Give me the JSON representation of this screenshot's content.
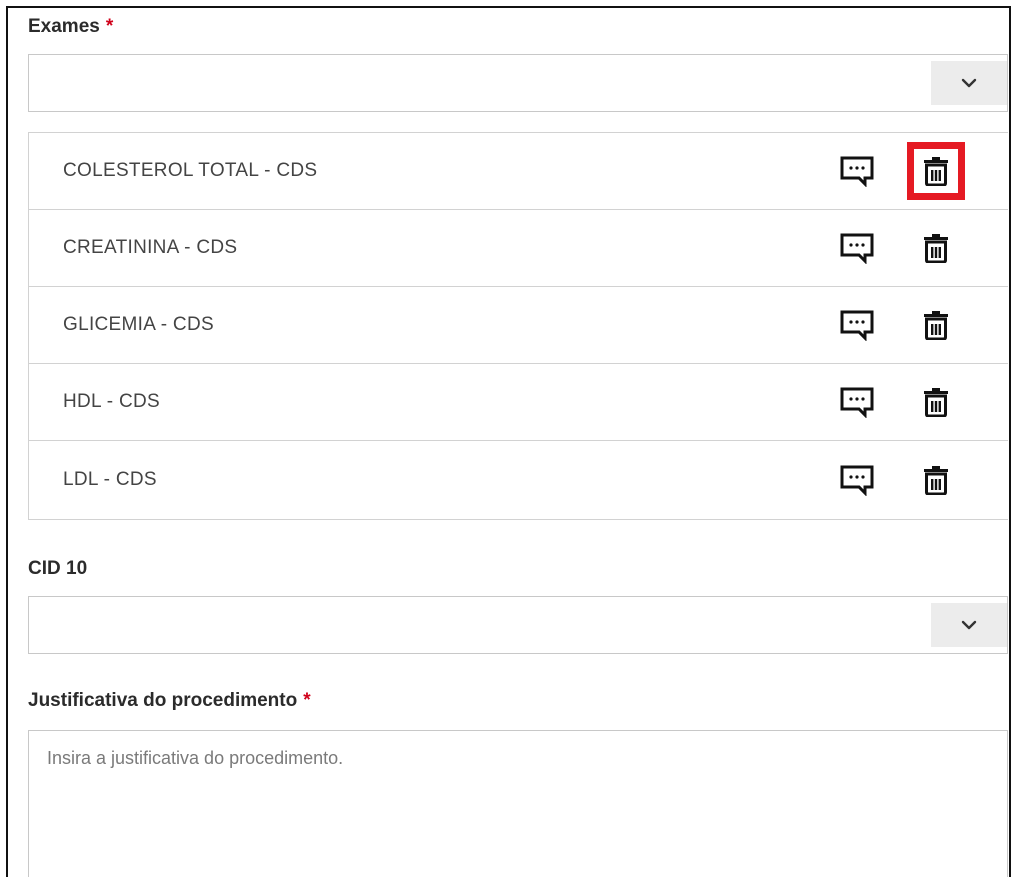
{
  "exames": {
    "label": "Exames",
    "required_mark": "*",
    "selected_value": "",
    "items": [
      {
        "label": "COLESTEROL TOTAL - CDS"
      },
      {
        "label": "CREATININA - CDS"
      },
      {
        "label": "GLICEMIA - CDS"
      },
      {
        "label": "HDL - CDS"
      },
      {
        "label": "LDL - CDS"
      }
    ]
  },
  "cid10": {
    "label": "CID 10",
    "selected_value": ""
  },
  "justificativa": {
    "label": "Justificativa do procedimento",
    "required_mark": "*",
    "placeholder": "Insira a justificativa do procedimento."
  },
  "colors": {
    "required": "#d0021b",
    "highlight": "#e51a23",
    "border": "#c8c8c8"
  },
  "icons": {
    "select_toggle": "chevron-down-icon",
    "comment": "comment-icon",
    "delete": "trash-icon"
  }
}
